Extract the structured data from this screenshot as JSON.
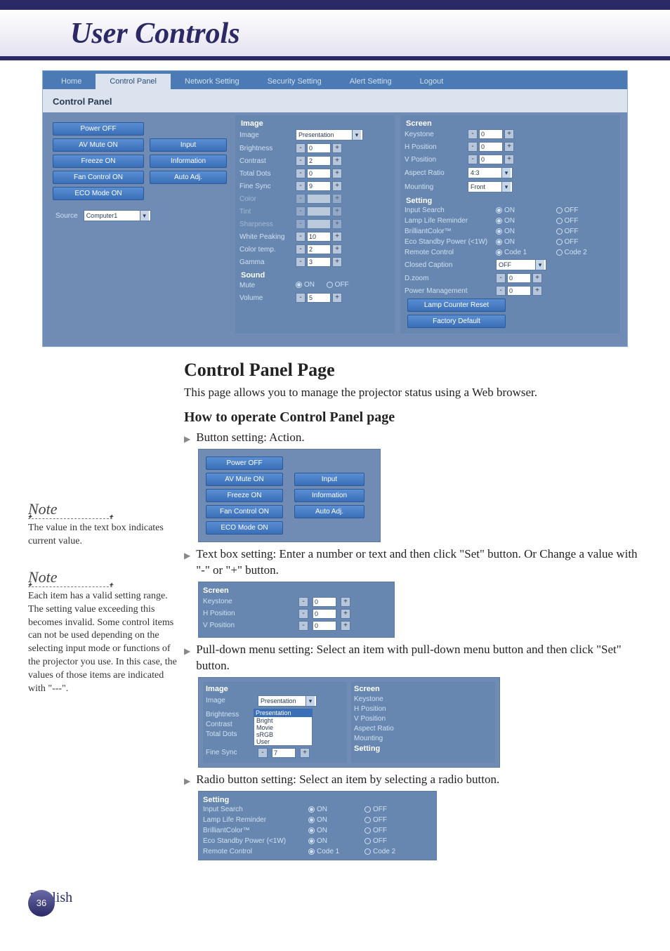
{
  "header": {
    "title": "User Controls"
  },
  "tabs": [
    "Home",
    "Control Panel",
    "Network Setting",
    "Security Setting",
    "Alert Setting",
    "Logout"
  ],
  "cp": {
    "title": "Control Panel",
    "left_buttons_col1": [
      "Power OFF",
      "AV Mute ON",
      "Freeze ON",
      "Fan Control ON",
      "ECO Mode ON"
    ],
    "left_buttons_col2": [
      "Input",
      "Information",
      "Auto Adj."
    ],
    "source_label": "Source",
    "source_value": "Computer1",
    "image": {
      "title": "Image",
      "rows": [
        {
          "label": "Image",
          "type": "sel",
          "value": "Presentation"
        },
        {
          "label": "Brightness",
          "type": "spin",
          "value": "0"
        },
        {
          "label": "Contrast",
          "type": "spin",
          "value": "2"
        },
        {
          "label": "Total Dots",
          "type": "spin",
          "value": "0"
        },
        {
          "label": "Fine Sync",
          "type": "spin",
          "value": "9"
        },
        {
          "label": "Color",
          "type": "spin",
          "value": "",
          "dim": true
        },
        {
          "label": "Tint",
          "type": "spin",
          "value": "",
          "dim": true
        },
        {
          "label": "Sharpness",
          "type": "spin",
          "value": "",
          "dim": true
        },
        {
          "label": "White Peaking",
          "type": "spin",
          "value": "10"
        },
        {
          "label": "Color temp.",
          "type": "spin",
          "value": "2"
        },
        {
          "label": "Gamma",
          "type": "spin",
          "value": "3"
        }
      ],
      "sound_title": "Sound",
      "mute_label": "Mute",
      "mute_on": "ON",
      "mute_off": "OFF",
      "volume_label": "Volume",
      "volume_value": "5"
    },
    "screen": {
      "title": "Screen",
      "rows": [
        {
          "label": "Keystone",
          "type": "spin",
          "value": "0"
        },
        {
          "label": "H Position",
          "type": "spin",
          "value": "0"
        },
        {
          "label": "V Position",
          "type": "spin",
          "value": "0"
        },
        {
          "label": "Aspect Ratio",
          "type": "sel",
          "value": "4:3"
        },
        {
          "label": "Mounting",
          "type": "sel",
          "value": "Front"
        }
      ],
      "setting_title": "Setting",
      "radios": [
        {
          "label": "Input Search",
          "a": "ON",
          "b": "OFF"
        },
        {
          "label": "Lamp Life Reminder",
          "a": "ON",
          "b": "OFF"
        },
        {
          "label": "BrilliantColor™",
          "a": "ON",
          "b": "OFF"
        },
        {
          "label": "Eco Standby Power (<1W)",
          "a": "ON",
          "b": "OFF"
        },
        {
          "label": "Remote Control",
          "a": "Code 1",
          "b": "Code 2"
        }
      ],
      "closed_caption_label": "Closed Caption",
      "closed_caption_value": "OFF",
      "dzoom_label": "D.zoom",
      "dzoom_value": "0",
      "power_mgmt_label": "Power Management",
      "power_mgmt_value": "0",
      "lamp_reset": "Lamp Counter Reset",
      "factory": "Factory Default"
    }
  },
  "body": {
    "h2": "Control Panel Page",
    "p1": "This page allows you to manage the projector status using a Web browser.",
    "h3": "How to operate Control Panel page",
    "b1": "Button setting: Action.",
    "b2": "Text box setting: Enter a number or text and then click \"Set\" button. Or Change a value with \"-\" or \"+\" button.",
    "b3": "Pull-down menu setting: Select an item with pull-down menu button and then click \"Set\" button.",
    "b4": "Radio button setting: Select an item by selecting a radio button."
  },
  "note1": {
    "title": "Note",
    "text": "The value in the text box indicates current value."
  },
  "note2": {
    "title": "Note",
    "text": "Each item has a valid setting range. The setting value exceeding this becomes invalid. Some control items can not be used depending on the selecting input mode or functions of the projector you use. In this case, the values of those items are indicated with \"---\"."
  },
  "mini_buttons": {
    "col1": [
      "Power OFF",
      "AV Mute ON",
      "Freeze ON",
      "Fan Control ON",
      "ECO Mode ON"
    ],
    "col2": [
      "Input",
      "Information",
      "Auto Adj."
    ]
  },
  "mini_screen": {
    "title": "Screen",
    "rows": [
      {
        "label": "Keystone",
        "value": "0"
      },
      {
        "label": "H Position",
        "value": "0"
      },
      {
        "label": "V Position",
        "value": "0"
      }
    ]
  },
  "mini_pull": {
    "left": {
      "title": "Image",
      "rows": [
        "Image",
        "Brightness",
        "Contrast",
        "Total Dots",
        "Fine Sync"
      ],
      "sel": "Presentation",
      "opts": [
        "Presentation",
        "Bright",
        "Movie",
        "sRGB",
        "User"
      ],
      "fine_val": "7"
    },
    "right": {
      "title": "Screen",
      "rows": [
        "Keystone",
        "H Position",
        "V Position",
        "Aspect Ratio",
        "Mounting",
        "Setting"
      ]
    }
  },
  "mini_radio": {
    "title": "Setting",
    "rows": [
      {
        "label": "Input Search",
        "a": "ON",
        "b": "OFF"
      },
      {
        "label": "Lamp Life Reminder",
        "a": "ON",
        "b": "OFF"
      },
      {
        "label": "BrilliantColor™",
        "a": "ON",
        "b": "OFF"
      },
      {
        "label": "Eco Standby Power (<1W)",
        "a": "ON",
        "b": "OFF"
      },
      {
        "label": "Remote Control",
        "a": "Code 1",
        "b": "Code 2"
      }
    ]
  },
  "page_number": "36",
  "language": "English"
}
